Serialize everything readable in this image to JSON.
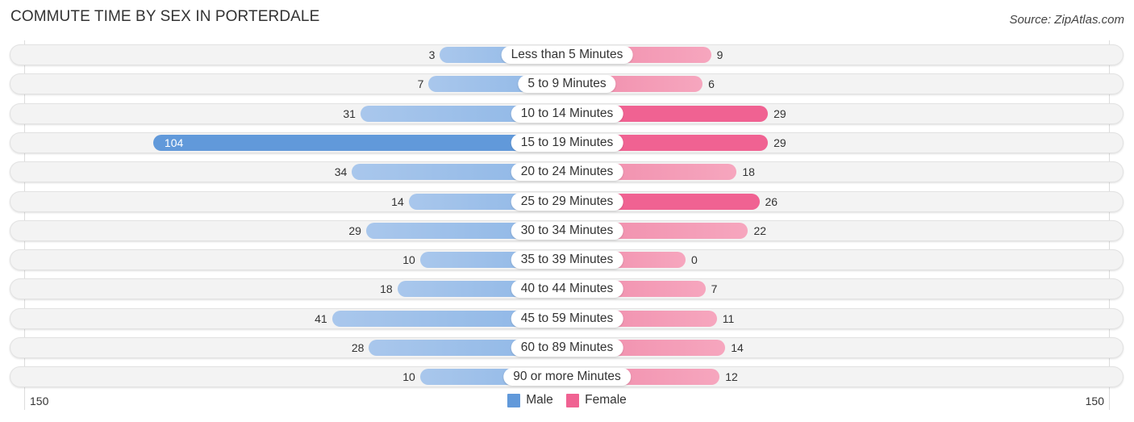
{
  "title": "COMMUTE TIME BY SEX IN PORTERDALE",
  "source": "Source: ZipAtlas.com",
  "colors": {
    "male": "#6199da",
    "female": "#f06292"
  },
  "chart_data": {
    "type": "bar",
    "orientation": "horizontal-diverging",
    "title": "COMMUTE TIME BY SEX IN PORTERDALE",
    "categories": [
      "Less than 5 Minutes",
      "5 to 9 Minutes",
      "10 to 14 Minutes",
      "15 to 19 Minutes",
      "20 to 24 Minutes",
      "25 to 29 Minutes",
      "30 to 34 Minutes",
      "35 to 39 Minutes",
      "40 to 44 Minutes",
      "45 to 59 Minutes",
      "60 to 89 Minutes",
      "90 or more Minutes"
    ],
    "series": [
      {
        "name": "Male",
        "values": [
          3,
          7,
          31,
          104,
          34,
          14,
          29,
          10,
          18,
          41,
          28,
          10
        ]
      },
      {
        "name": "Female",
        "values": [
          9,
          6,
          29,
          29,
          18,
          26,
          22,
          0,
          7,
          11,
          14,
          12
        ]
      }
    ],
    "axis": {
      "left_label": "150",
      "right_label": "150",
      "max": 150
    },
    "legend": [
      "Male",
      "Female"
    ],
    "legend_position": "bottom-center"
  }
}
